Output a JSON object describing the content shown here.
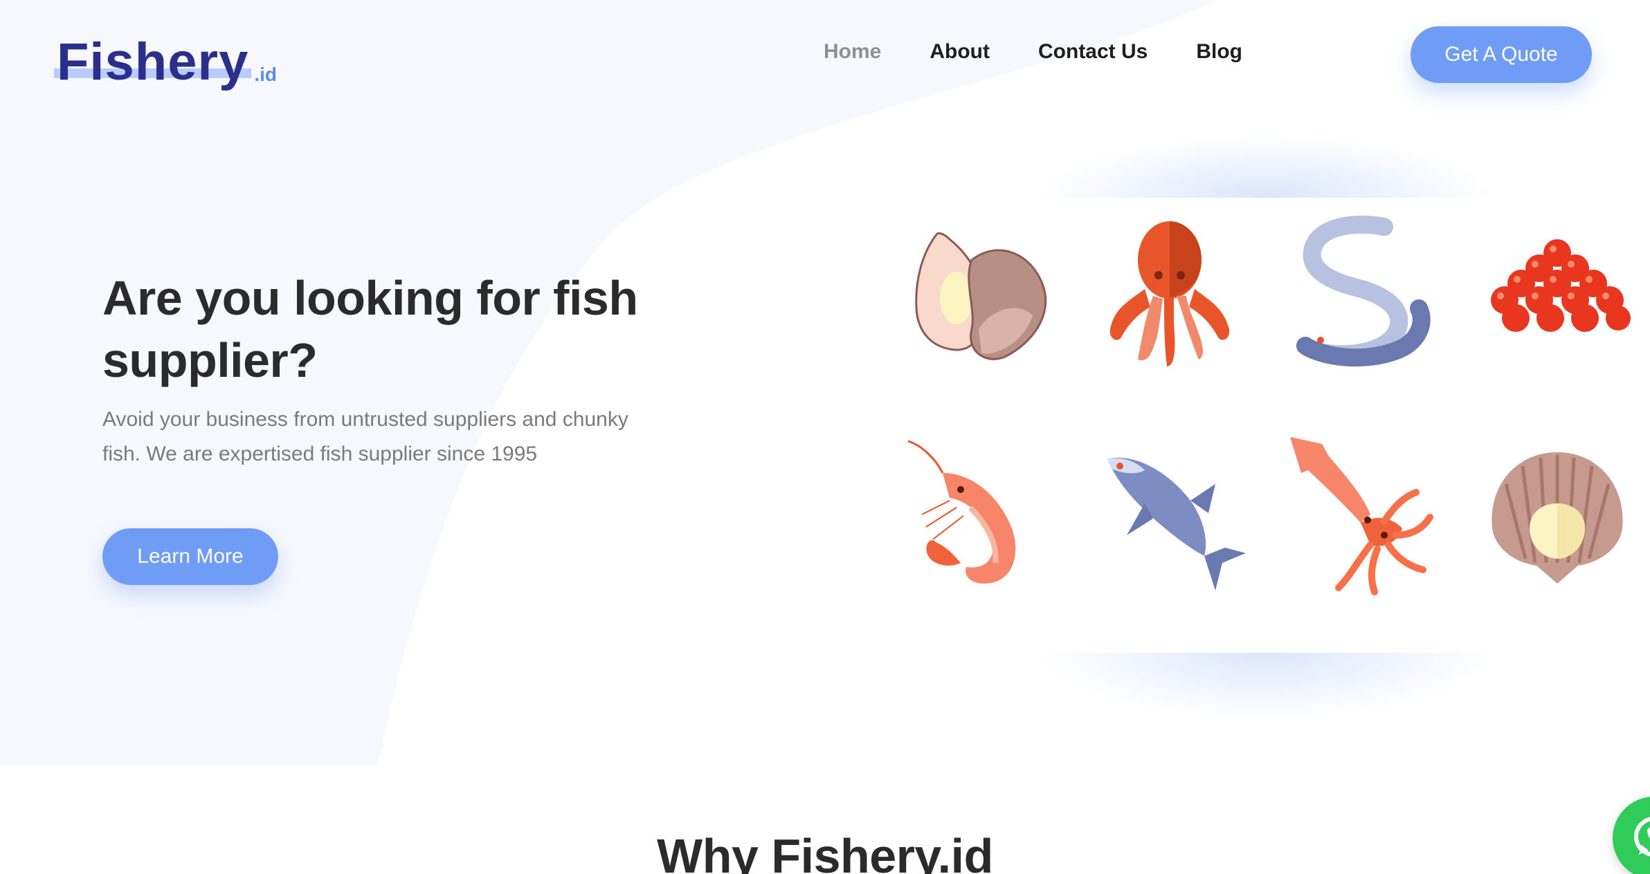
{
  "brand": {
    "name": "Fishery",
    "suffix": ".id"
  },
  "nav": {
    "links": [
      {
        "label": "Home",
        "active": true
      },
      {
        "label": "About",
        "active": false
      },
      {
        "label": "Contact Us",
        "active": false
      },
      {
        "label": "Blog",
        "active": false
      }
    ],
    "cta_label": "Get A Quote"
  },
  "hero": {
    "title": "Are you looking for fish supplier?",
    "description": "Avoid your business from untrusted suppliers and chunky fish. We are expertised fish supplier since 1995",
    "button_label": "Learn More"
  },
  "seafood": {
    "items": [
      {
        "name": "oyster",
        "icon": "oyster-icon"
      },
      {
        "name": "octopus",
        "icon": "octopus-icon"
      },
      {
        "name": "eel",
        "icon": "eel-icon"
      },
      {
        "name": "caviar",
        "icon": "caviar-icon"
      },
      {
        "name": "shrimp",
        "icon": "shrimp-icon"
      },
      {
        "name": "tuna",
        "icon": "tuna-icon"
      },
      {
        "name": "squid",
        "icon": "squid-icon"
      },
      {
        "name": "scallop",
        "icon": "scallop-icon"
      }
    ]
  },
  "section": {
    "title": "Why Fishery.id"
  },
  "colors": {
    "accent": "#6f9cf5",
    "logo": "#2a2f8c",
    "hero_bg": "#f7f8fd",
    "whatsapp": "#2fcc5a"
  }
}
